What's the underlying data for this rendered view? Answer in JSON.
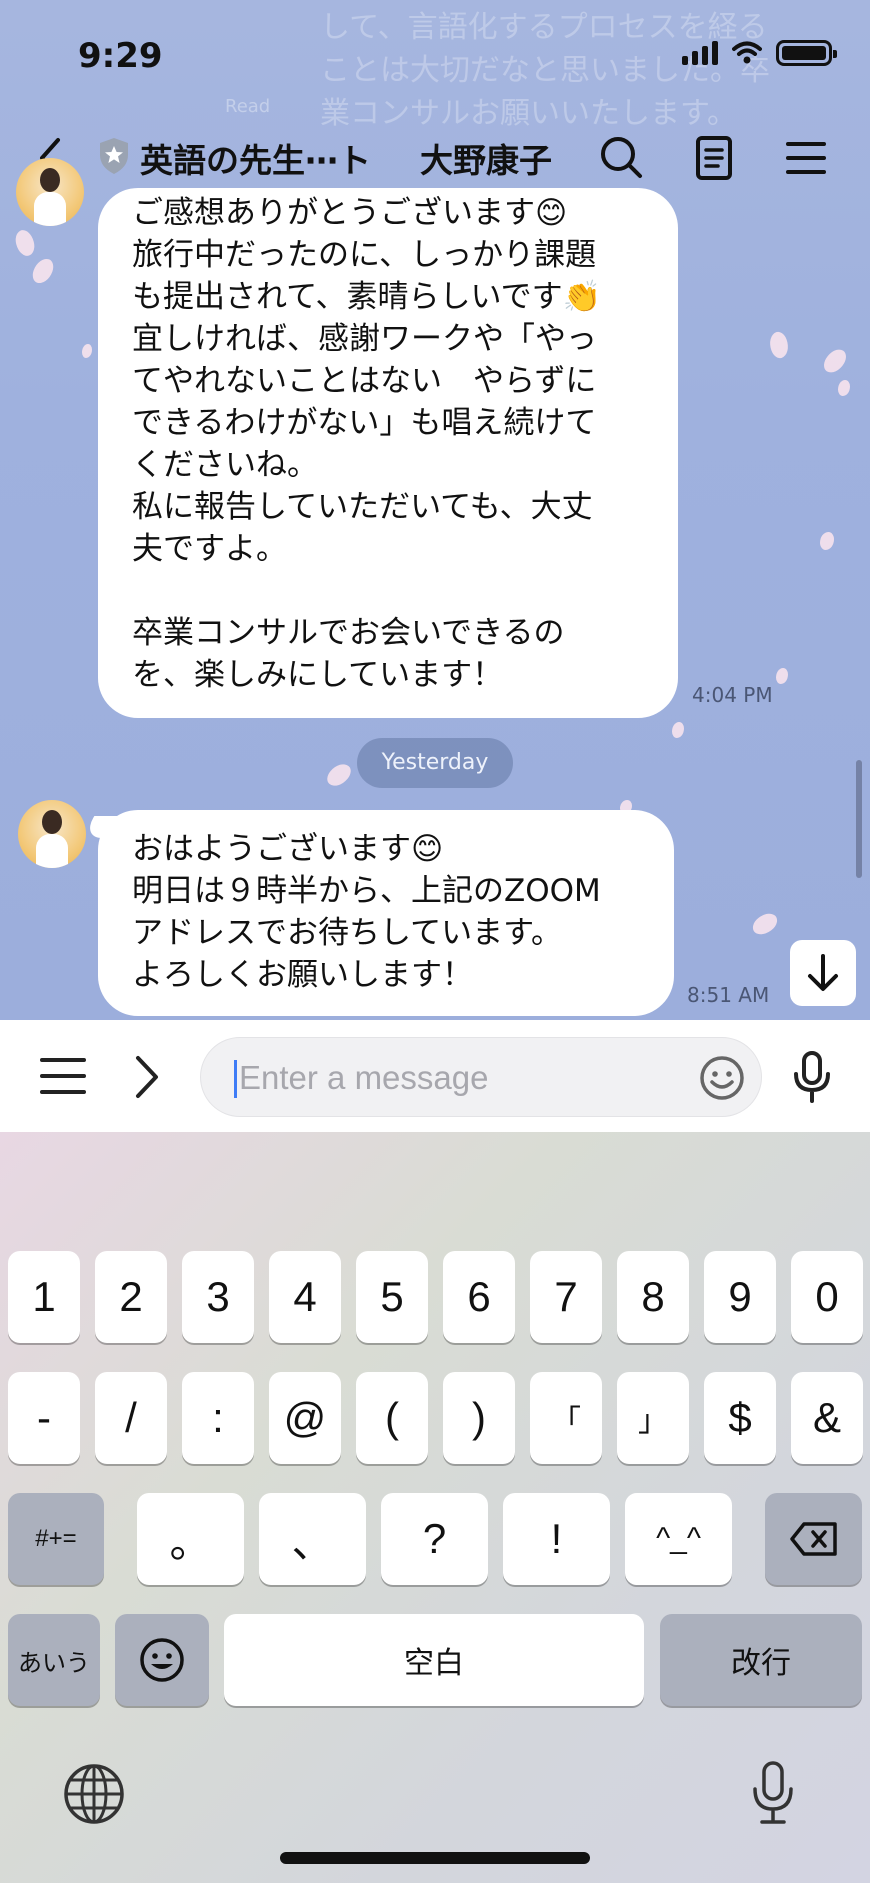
{
  "status_bar": {
    "time": "9:29"
  },
  "background_ghost": {
    "text": "して、言語化するプロセスを経る\nことは大切だなと思いました。卒\n業コンサルお願いいたします。",
    "read_label": "Read"
  },
  "header": {
    "chat_title": "英語の先生⋯ト",
    "user_name": "大野康子",
    "icons": [
      "back-chevron-icon",
      "shield-star-icon",
      "search-icon",
      "notes-icon",
      "menu-icon"
    ]
  },
  "messages": [
    {
      "text": "ご感想ありがとうございます😊\n旅行中だったのに、しっかり課題\nも提出されて、素晴らしいです👏\n宜しければ、感謝ワークや「やっ\nてやれないことはない　やらずに\nできるわけがない」も唱え続けて\nくださいね。\n私に報告していただいても、大丈\n夫ですよ。\n\n卒業コンサルでお会いできるの\nを、楽しみにしています！",
      "time": "4:04 PM"
    },
    {
      "text": "おはようございます😊\n明日は９時半から、上記のZOOM\nアドレスでお待ちしています。\nよろしくお願いします！",
      "time": "8:51 AM"
    }
  ],
  "date_separator": "Yesterday",
  "input_bar": {
    "placeholder": "Enter a message",
    "value": ""
  },
  "keyboard": {
    "row1": [
      "1",
      "2",
      "3",
      "4",
      "5",
      "6",
      "7",
      "8",
      "9",
      "0"
    ],
    "row2": [
      "-",
      "/",
      ":",
      "@",
      "(",
      ")",
      "「",
      "」",
      "$",
      "&"
    ],
    "row3_left": "#+=",
    "row3": [
      "。",
      "、",
      "?",
      "!",
      "^_^"
    ],
    "row4_left": "あいう",
    "space": "空白",
    "return": "改行"
  },
  "colors": {
    "chat_background": "#9fb1de",
    "bubble": "#ffffff",
    "date_chip": "#788cb9",
    "caret": "#3f7cf6"
  }
}
